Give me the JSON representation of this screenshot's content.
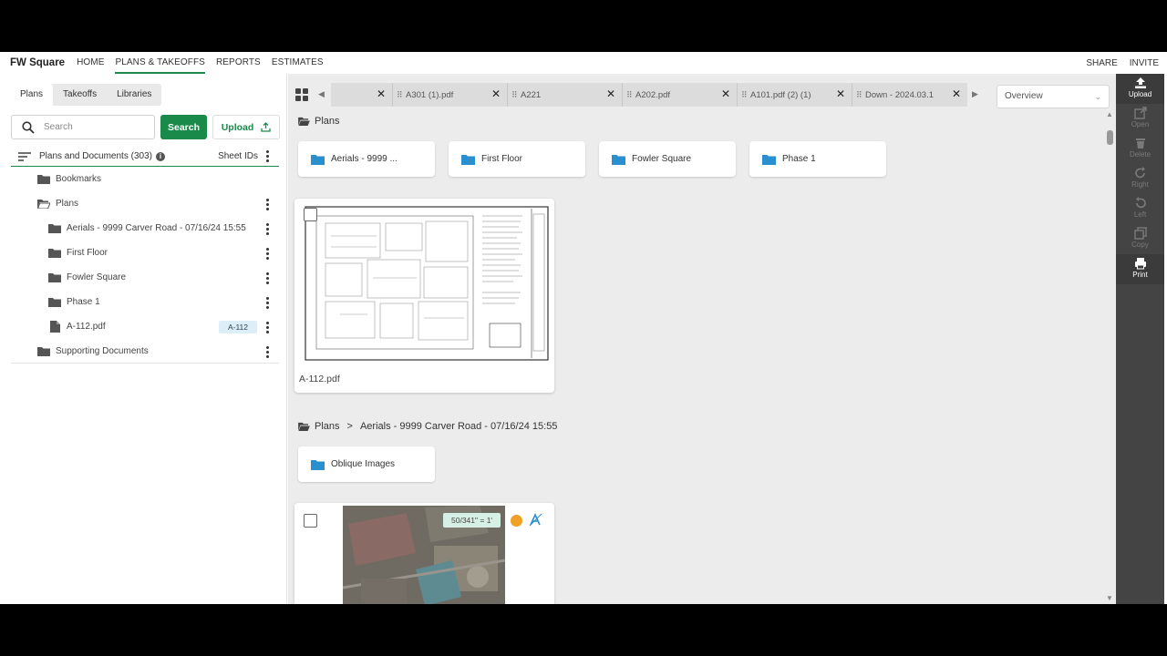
{
  "topnav": {
    "brand": "FW Square",
    "items": [
      "HOME",
      "PLANS & TAKEOFFS",
      "REPORTS",
      "ESTIMATES"
    ],
    "right": [
      "SHARE",
      "INVITE"
    ]
  },
  "left": {
    "tabs": [
      "Plans",
      "Takeoffs",
      "Libraries"
    ],
    "search_placeholder": "Search",
    "search_button": "Search",
    "upload_button": "Upload",
    "tree_title": "Plans and Documents (303)",
    "sheet_ids": "Sheet IDs",
    "tree": [
      {
        "label": "Bookmarks",
        "type": "folder",
        "indent": 0
      },
      {
        "label": "Plans",
        "type": "folder-open",
        "indent": 0
      },
      {
        "label": "Aerials - 9999 Carver Road - 07/16/24 15:55",
        "type": "folder",
        "indent": 1
      },
      {
        "label": "First Floor",
        "type": "folder",
        "indent": 1
      },
      {
        "label": "Fowler Square",
        "type": "folder",
        "indent": 1
      },
      {
        "label": "Phase 1",
        "type": "folder",
        "indent": 1
      },
      {
        "label": "A-112.pdf",
        "type": "file",
        "indent": 1,
        "badge": "A-112"
      },
      {
        "label": "Supporting Documents",
        "type": "folder",
        "indent": 0
      }
    ]
  },
  "tabs": [
    {
      "label": ""
    },
    {
      "label": "A301 (1).pdf"
    },
    {
      "label": "A221"
    },
    {
      "label": "A202.pdf"
    },
    {
      "label": "A101.pdf (2) (1)"
    },
    {
      "label": "Down - 2024.03.1"
    }
  ],
  "overview": "Overview",
  "content": {
    "section1_crumb": "Plans",
    "folders1": [
      "Aerials - 9999 ...",
      "First Floor",
      "Fowler Square",
      "Phase 1"
    ],
    "plan1_name": "A-112.pdf",
    "section2_crumb_root": "Plans",
    "section2_crumb_sep": ">",
    "section2_crumb_leaf": "Aerials - 9999 Carver Road - 07/16/24 15:55",
    "folders2": [
      "Oblique Images"
    ],
    "scale_label": "50/341\" = 1'"
  },
  "toolbar": [
    "Upload",
    "Open",
    "Delete",
    "Right",
    "Left",
    "Copy",
    "Print"
  ],
  "colors": {
    "accent": "#1a8a4a",
    "folder": "#2a8fcf",
    "toolbar": "#444444"
  }
}
